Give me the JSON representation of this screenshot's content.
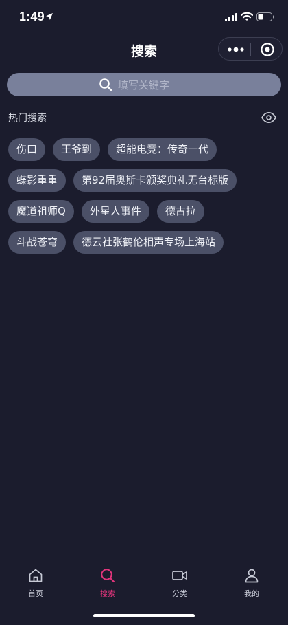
{
  "status_bar": {
    "time": "1:49",
    "icons": [
      "location-arrow-icon",
      "signal-icon",
      "wifi-icon",
      "battery-icon"
    ]
  },
  "nav": {
    "title": "搜索",
    "capsule_icons": [
      "more-icon",
      "close-target-icon"
    ]
  },
  "search": {
    "placeholder": "填写关键字"
  },
  "hot_search": {
    "title": "热门搜索",
    "toggle_icon": "eye-icon",
    "tags": [
      [
        "伤口",
        "王爷到",
        "超能电竞：传奇一代"
      ],
      [
        "蝶影重重",
        "第92届奥斯卡颁奖典礼无台标版"
      ],
      [
        "魔道祖师Q",
        "外星人事件",
        "德古拉"
      ],
      [
        "斗战苍穹",
        "德云社张鹤伦相声专场上海站"
      ]
    ]
  },
  "tabs": [
    {
      "label": "首页",
      "icon": "home-icon",
      "active": false
    },
    {
      "label": "搜索",
      "icon": "search-icon",
      "active": true
    },
    {
      "label": "分类",
      "icon": "video-camera-icon",
      "active": false
    },
    {
      "label": "我的",
      "icon": "user-icon",
      "active": false
    }
  ],
  "colors": {
    "background": "#1b1c2d",
    "accent": "#e2357c",
    "tag_bg": "#4b5067",
    "search_bg": "#79809b"
  }
}
